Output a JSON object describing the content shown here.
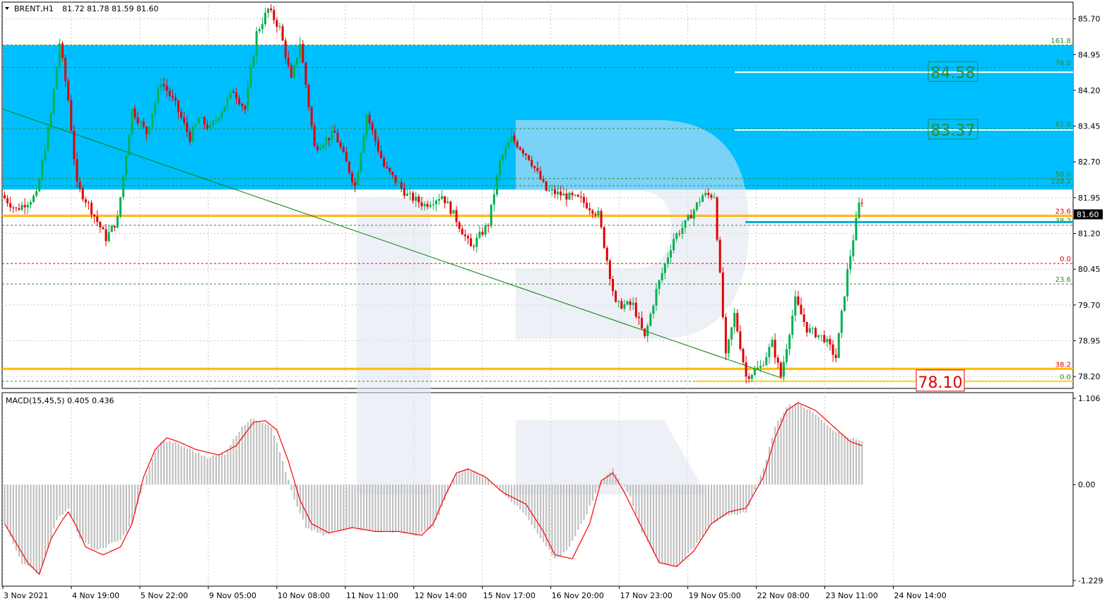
{
  "header": {
    "symbol": "BRENT,H1",
    "ohlc": "81.72 81.78 81.59 81.60"
  },
  "macd_header": "MACD(15,45,5) 0.405 0.436",
  "colors": {
    "bull": "#00b050",
    "bear": "#e00000",
    "zone": "#00bfff",
    "fib_orange": "#ffa500",
    "fib_yellow": "#ffd700",
    "trendline": "#008000",
    "macd_hist": "#c0c0c0",
    "macd_signal": "#ff0000",
    "current_line": "#00b0d8"
  },
  "chart_data": {
    "type": "candlestick",
    "price_axis": {
      "ylim": [
        77.95,
        86.05
      ],
      "ticks": [
        "85.70",
        "84.95",
        "84.20",
        "83.45",
        "82.70",
        "81.95",
        "81.20",
        "80.45",
        "79.70",
        "78.95",
        "78.20"
      ],
      "current_price": "81.60"
    },
    "time_axis": {
      "labels": [
        "3 Nov 2021",
        "4 Nov 19:00",
        "5 Nov 22:00",
        "9 Nov 05:00",
        "10 Nov 08:00",
        "11 Nov 11:00",
        "12 Nov 14:00",
        "15 Nov 17:00",
        "16 Nov 20:00",
        "17 Nov 23:00",
        "19 Nov 05:00",
        "22 Nov 08:00",
        "23 Nov 11:00",
        "24 Nov 14:00"
      ],
      "bars": 297
    },
    "zone": {
      "from": 82.12,
      "to": 85.15
    },
    "fib_levels": [
      {
        "label": "161.8",
        "value": 85.15,
        "style": "dashed-green"
      },
      {
        "label": "76.0",
        "value": 84.68,
        "style": "dashed-green"
      },
      {
        "label": "61.8",
        "value": 83.4,
        "style": "dashed-green"
      },
      {
        "label": "50.0",
        "value": 82.35,
        "style": "dashed-green"
      },
      {
        "label": "138.2",
        "value": 82.2,
        "style": "dashed-green"
      },
      {
        "label": "23.6",
        "value": 81.57,
        "style": "orange"
      },
      {
        "label": "38.2",
        "value": 81.37,
        "style": "dashed-green"
      },
      {
        "label": "0.0",
        "value": 80.57,
        "style": "dashed-red"
      },
      {
        "label": "23.6",
        "value": 80.14,
        "style": "dashed-green"
      },
      {
        "label": "38.2",
        "value": 78.36,
        "style": "orange"
      },
      {
        "label": "0.0",
        "value": 78.1,
        "style": "yellow"
      }
    ],
    "targets": [
      {
        "label": "84.58",
        "value": 84.58
      },
      {
        "label": "83.37",
        "value": 83.37
      }
    ],
    "support_box": {
      "label": "78.10",
      "value": 78.1
    },
    "trendline": {
      "from": {
        "x": 0,
        "y": 83.8
      },
      "to": {
        "x": 269,
        "y": 78.16
      }
    },
    "anchors": [
      [
        0,
        82.0
      ],
      [
        5,
        81.7
      ],
      [
        12,
        82.0
      ],
      [
        17,
        83.7
      ],
      [
        20,
        85.2
      ],
      [
        23,
        84.0
      ],
      [
        26,
        82.2
      ],
      [
        30,
        81.8
      ],
      [
        36,
        81.1
      ],
      [
        40,
        81.5
      ],
      [
        45,
        83.8
      ],
      [
        50,
        83.3
      ],
      [
        55,
        84.4
      ],
      [
        60,
        83.9
      ],
      [
        65,
        83.2
      ],
      [
        68,
        83.6
      ],
      [
        72,
        83.4
      ],
      [
        80,
        84.2
      ],
      [
        84,
        83.8
      ],
      [
        88,
        85.4
      ],
      [
        92,
        85.9
      ],
      [
        96,
        85.5
      ],
      [
        100,
        84.4
      ],
      [
        103,
        85.2
      ],
      [
        108,
        83.0
      ],
      [
        115,
        83.3
      ],
      [
        122,
        82.2
      ],
      [
        126,
        83.7
      ],
      [
        132,
        82.6
      ],
      [
        140,
        82.0
      ],
      [
        146,
        81.8
      ],
      [
        152,
        82.0
      ],
      [
        156,
        81.6
      ],
      [
        162,
        80.9
      ],
      [
        168,
        81.4
      ],
      [
        172,
        82.7
      ],
      [
        176,
        83.2
      ],
      [
        182,
        82.8
      ],
      [
        188,
        82.1
      ],
      [
        194,
        82.0
      ],
      [
        200,
        81.9
      ],
      [
        206,
        81.6
      ],
      [
        212,
        79.7
      ],
      [
        218,
        79.7
      ],
      [
        222,
        79.0
      ],
      [
        226,
        80.0
      ],
      [
        232,
        81.1
      ],
      [
        236,
        81.4
      ],
      [
        242,
        82.0
      ],
      [
        246,
        82.0
      ],
      [
        250,
        78.6
      ],
      [
        253,
        79.5
      ],
      [
        257,
        78.2
      ],
      [
        262,
        78.4
      ],
      [
        266,
        78.9
      ],
      [
        269,
        78.2
      ],
      [
        274,
        79.8
      ],
      [
        278,
        79.2
      ],
      [
        284,
        79.0
      ],
      [
        288,
        78.6
      ],
      [
        292,
        80.4
      ],
      [
        296,
        81.8
      ],
      [
        300,
        82.2
      ],
      [
        305,
        81.6
      ],
      [
        310,
        82.2
      ],
      [
        315,
        81.4
      ],
      [
        320,
        81.7
      ],
      [
        322,
        81.6
      ]
    ],
    "macd": {
      "zero": "0.00",
      "ylim": [
        -1.229,
        1.106
      ],
      "ticks": [
        "1.106",
        "0.00",
        "-1.229"
      ],
      "hist_anchors": [
        [
          0,
          -0.5
        ],
        [
          6,
          -1.0
        ],
        [
          12,
          -1.15
        ],
        [
          18,
          -0.45
        ],
        [
          22,
          -0.3
        ],
        [
          26,
          -0.7
        ],
        [
          32,
          -0.85
        ],
        [
          40,
          -0.7
        ],
        [
          44,
          -0.5
        ],
        [
          50,
          0.25
        ],
        [
          54,
          0.55
        ],
        [
          58,
          0.55
        ],
        [
          64,
          0.45
        ],
        [
          70,
          0.35
        ],
        [
          76,
          0.4
        ],
        [
          82,
          0.75
        ],
        [
          86,
          0.85
        ],
        [
          92,
          0.75
        ],
        [
          96,
          0.3
        ],
        [
          100,
          -0.2
        ],
        [
          104,
          -0.55
        ],
        [
          110,
          -0.65
        ],
        [
          120,
          -0.55
        ],
        [
          128,
          -0.6
        ],
        [
          136,
          -0.6
        ],
        [
          142,
          -0.65
        ],
        [
          148,
          -0.55
        ],
        [
          152,
          -0.2
        ],
        [
          156,
          0.15
        ],
        [
          160,
          0.2
        ],
        [
          166,
          0.1
        ],
        [
          172,
          -0.1
        ],
        [
          180,
          -0.4
        ],
        [
          186,
          -0.75
        ],
        [
          190,
          -0.95
        ],
        [
          194,
          -0.85
        ],
        [
          200,
          -0.45
        ],
        [
          206,
          0.05
        ],
        [
          210,
          0.2
        ],
        [
          216,
          -0.15
        ],
        [
          220,
          -0.6
        ],
        [
          226,
          -1.0
        ],
        [
          232,
          -1.05
        ],
        [
          238,
          -0.8
        ],
        [
          244,
          -0.5
        ],
        [
          250,
          -0.4
        ],
        [
          256,
          -0.35
        ],
        [
          262,
          0.2
        ],
        [
          266,
          0.75
        ],
        [
          270,
          1.0
        ],
        [
          274,
          1.05
        ],
        [
          280,
          0.9
        ],
        [
          286,
          0.7
        ],
        [
          292,
          0.6
        ],
        [
          296,
          0.55
        ]
      ],
      "sig_anchors": [
        [
          0,
          -0.5
        ],
        [
          4,
          -0.75
        ],
        [
          8,
          -1.0
        ],
        [
          12,
          -1.15
        ],
        [
          16,
          -0.7
        ],
        [
          20,
          -0.45
        ],
        [
          22,
          -0.35
        ],
        [
          25,
          -0.55
        ],
        [
          28,
          -0.8
        ],
        [
          34,
          -0.9
        ],
        [
          40,
          -0.8
        ],
        [
          44,
          -0.5
        ],
        [
          48,
          0.1
        ],
        [
          52,
          0.45
        ],
        [
          56,
          0.6
        ],
        [
          60,
          0.55
        ],
        [
          66,
          0.45
        ],
        [
          74,
          0.38
        ],
        [
          80,
          0.5
        ],
        [
          86,
          0.8
        ],
        [
          90,
          0.82
        ],
        [
          94,
          0.7
        ],
        [
          98,
          0.3
        ],
        [
          102,
          -0.2
        ],
        [
          106,
          -0.5
        ],
        [
          112,
          -0.62
        ],
        [
          120,
          -0.55
        ],
        [
          128,
          -0.6
        ],
        [
          136,
          -0.6
        ],
        [
          144,
          -0.65
        ],
        [
          148,
          -0.5
        ],
        [
          152,
          -0.15
        ],
        [
          156,
          0.15
        ],
        [
          160,
          0.2
        ],
        [
          166,
          0.1
        ],
        [
          172,
          -0.1
        ],
        [
          180,
          -0.25
        ],
        [
          186,
          -0.6
        ],
        [
          190,
          -0.9
        ],
        [
          196,
          -0.95
        ],
        [
          202,
          -0.5
        ],
        [
          206,
          0.05
        ],
        [
          210,
          0.15
        ],
        [
          214,
          -0.1
        ],
        [
          220,
          -0.55
        ],
        [
          226,
          -1.0
        ],
        [
          232,
          -1.05
        ],
        [
          238,
          -0.85
        ],
        [
          244,
          -0.5
        ],
        [
          250,
          -0.35
        ],
        [
          256,
          -0.3
        ],
        [
          262,
          0.1
        ],
        [
          266,
          0.6
        ],
        [
          270,
          0.95
        ],
        [
          274,
          1.05
        ],
        [
          280,
          0.95
        ],
        [
          286,
          0.75
        ],
        [
          292,
          0.55
        ],
        [
          296,
          0.5
        ]
      ]
    }
  }
}
